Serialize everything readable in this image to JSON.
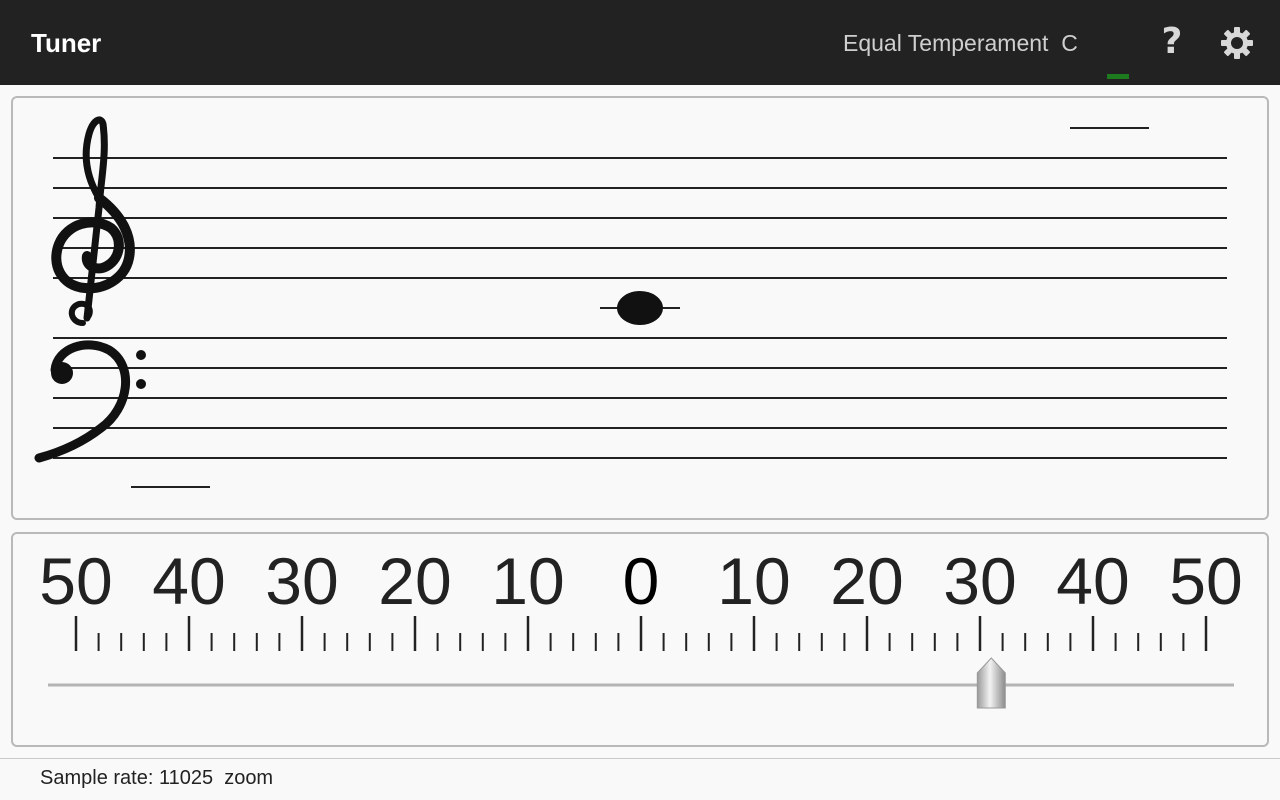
{
  "app_bar": {
    "title": "Tuner",
    "temperament_label": "Equal Temperament  C",
    "help_icon": "help-icon",
    "help_glyph": "?",
    "settings_icon": "gear-icon",
    "background_color": "#222222",
    "signal_indicator_color": "#1e7a1e"
  },
  "staff": {
    "clefs": [
      "treble-clef",
      "bass-clef"
    ],
    "note": "whole-note"
  },
  "meter": {
    "scale_labels": [
      "50",
      "40",
      "30",
      "20",
      "10",
      "0",
      "10",
      "20",
      "30",
      "40",
      "50"
    ],
    "cents_range": [
      -50,
      50
    ],
    "needle_cents": 31,
    "slider_icon": "pointer-thumb-icon"
  },
  "status": {
    "text": "Sample rate: 11025  zoom"
  }
}
